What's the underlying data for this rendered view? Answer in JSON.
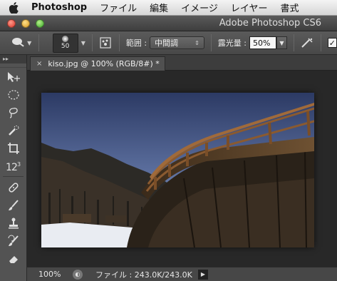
{
  "menubar": {
    "app_name": "Photoshop",
    "items": [
      "ファイル",
      "編集",
      "イメージ",
      "レイヤー",
      "書式"
    ]
  },
  "window": {
    "title": "Adobe Photoshop CS6"
  },
  "options": {
    "brush_size": "50",
    "range_label": "範囲 :",
    "range_value": "中間調",
    "exposure_label": "露光量 :",
    "exposure_value": "50%"
  },
  "tools_panel": {
    "collapse_glyph": "▸▸"
  },
  "document": {
    "tab_close": "×",
    "tab_title": "kiso.jpg @ 100% (RGB/8#) *"
  },
  "status": {
    "zoom": "100%",
    "file_info": "ファイル : 243.0K/243.0K",
    "arrow": "▶"
  },
  "colors": {
    "interface_dark": "#282828",
    "panel": "#535353",
    "sky_top": "#2c3a64",
    "bridge_wood": "#6b3e1e"
  }
}
